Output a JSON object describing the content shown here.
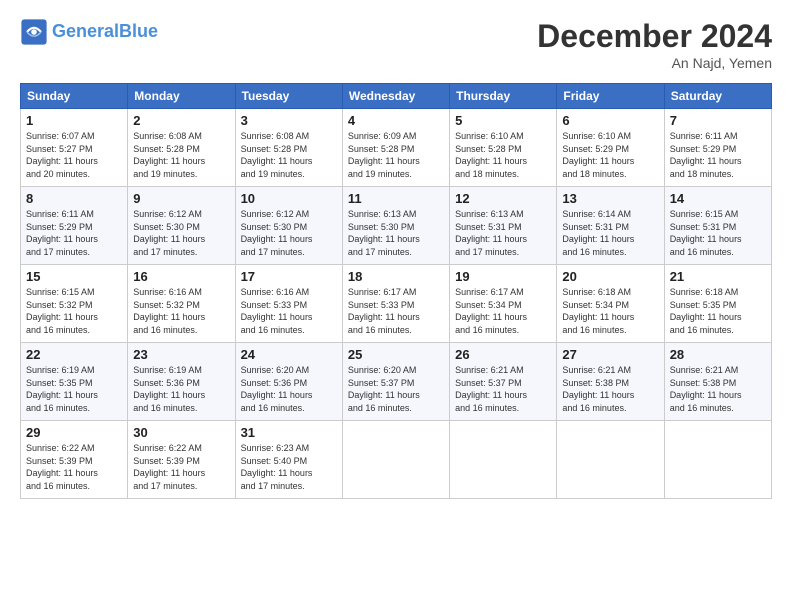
{
  "header": {
    "logo_line1": "General",
    "logo_line2": "Blue",
    "month_year": "December 2024",
    "location": "An Najd, Yemen"
  },
  "weekdays": [
    "Sunday",
    "Monday",
    "Tuesday",
    "Wednesday",
    "Thursday",
    "Friday",
    "Saturday"
  ],
  "weeks": [
    [
      {
        "day": "1",
        "info": "Sunrise: 6:07 AM\nSunset: 5:27 PM\nDaylight: 11 hours\nand 20 minutes."
      },
      {
        "day": "2",
        "info": "Sunrise: 6:08 AM\nSunset: 5:28 PM\nDaylight: 11 hours\nand 19 minutes."
      },
      {
        "day": "3",
        "info": "Sunrise: 6:08 AM\nSunset: 5:28 PM\nDaylight: 11 hours\nand 19 minutes."
      },
      {
        "day": "4",
        "info": "Sunrise: 6:09 AM\nSunset: 5:28 PM\nDaylight: 11 hours\nand 19 minutes."
      },
      {
        "day": "5",
        "info": "Sunrise: 6:10 AM\nSunset: 5:28 PM\nDaylight: 11 hours\nand 18 minutes."
      },
      {
        "day": "6",
        "info": "Sunrise: 6:10 AM\nSunset: 5:29 PM\nDaylight: 11 hours\nand 18 minutes."
      },
      {
        "day": "7",
        "info": "Sunrise: 6:11 AM\nSunset: 5:29 PM\nDaylight: 11 hours\nand 18 minutes."
      }
    ],
    [
      {
        "day": "8",
        "info": "Sunrise: 6:11 AM\nSunset: 5:29 PM\nDaylight: 11 hours\nand 17 minutes."
      },
      {
        "day": "9",
        "info": "Sunrise: 6:12 AM\nSunset: 5:30 PM\nDaylight: 11 hours\nand 17 minutes."
      },
      {
        "day": "10",
        "info": "Sunrise: 6:12 AM\nSunset: 5:30 PM\nDaylight: 11 hours\nand 17 minutes."
      },
      {
        "day": "11",
        "info": "Sunrise: 6:13 AM\nSunset: 5:30 PM\nDaylight: 11 hours\nand 17 minutes."
      },
      {
        "day": "12",
        "info": "Sunrise: 6:13 AM\nSunset: 5:31 PM\nDaylight: 11 hours\nand 17 minutes."
      },
      {
        "day": "13",
        "info": "Sunrise: 6:14 AM\nSunset: 5:31 PM\nDaylight: 11 hours\nand 16 minutes."
      },
      {
        "day": "14",
        "info": "Sunrise: 6:15 AM\nSunset: 5:31 PM\nDaylight: 11 hours\nand 16 minutes."
      }
    ],
    [
      {
        "day": "15",
        "info": "Sunrise: 6:15 AM\nSunset: 5:32 PM\nDaylight: 11 hours\nand 16 minutes."
      },
      {
        "day": "16",
        "info": "Sunrise: 6:16 AM\nSunset: 5:32 PM\nDaylight: 11 hours\nand 16 minutes."
      },
      {
        "day": "17",
        "info": "Sunrise: 6:16 AM\nSunset: 5:33 PM\nDaylight: 11 hours\nand 16 minutes."
      },
      {
        "day": "18",
        "info": "Sunrise: 6:17 AM\nSunset: 5:33 PM\nDaylight: 11 hours\nand 16 minutes."
      },
      {
        "day": "19",
        "info": "Sunrise: 6:17 AM\nSunset: 5:34 PM\nDaylight: 11 hours\nand 16 minutes."
      },
      {
        "day": "20",
        "info": "Sunrise: 6:18 AM\nSunset: 5:34 PM\nDaylight: 11 hours\nand 16 minutes."
      },
      {
        "day": "21",
        "info": "Sunrise: 6:18 AM\nSunset: 5:35 PM\nDaylight: 11 hours\nand 16 minutes."
      }
    ],
    [
      {
        "day": "22",
        "info": "Sunrise: 6:19 AM\nSunset: 5:35 PM\nDaylight: 11 hours\nand 16 minutes."
      },
      {
        "day": "23",
        "info": "Sunrise: 6:19 AM\nSunset: 5:36 PM\nDaylight: 11 hours\nand 16 minutes."
      },
      {
        "day": "24",
        "info": "Sunrise: 6:20 AM\nSunset: 5:36 PM\nDaylight: 11 hours\nand 16 minutes."
      },
      {
        "day": "25",
        "info": "Sunrise: 6:20 AM\nSunset: 5:37 PM\nDaylight: 11 hours\nand 16 minutes."
      },
      {
        "day": "26",
        "info": "Sunrise: 6:21 AM\nSunset: 5:37 PM\nDaylight: 11 hours\nand 16 minutes."
      },
      {
        "day": "27",
        "info": "Sunrise: 6:21 AM\nSunset: 5:38 PM\nDaylight: 11 hours\nand 16 minutes."
      },
      {
        "day": "28",
        "info": "Sunrise: 6:21 AM\nSunset: 5:38 PM\nDaylight: 11 hours\nand 16 minutes."
      }
    ],
    [
      {
        "day": "29",
        "info": "Sunrise: 6:22 AM\nSunset: 5:39 PM\nDaylight: 11 hours\nand 16 minutes."
      },
      {
        "day": "30",
        "info": "Sunrise: 6:22 AM\nSunset: 5:39 PM\nDaylight: 11 hours\nand 17 minutes."
      },
      {
        "day": "31",
        "info": "Sunrise: 6:23 AM\nSunset: 5:40 PM\nDaylight: 11 hours\nand 17 minutes."
      },
      {
        "day": "",
        "info": ""
      },
      {
        "day": "",
        "info": ""
      },
      {
        "day": "",
        "info": ""
      },
      {
        "day": "",
        "info": ""
      }
    ]
  ]
}
